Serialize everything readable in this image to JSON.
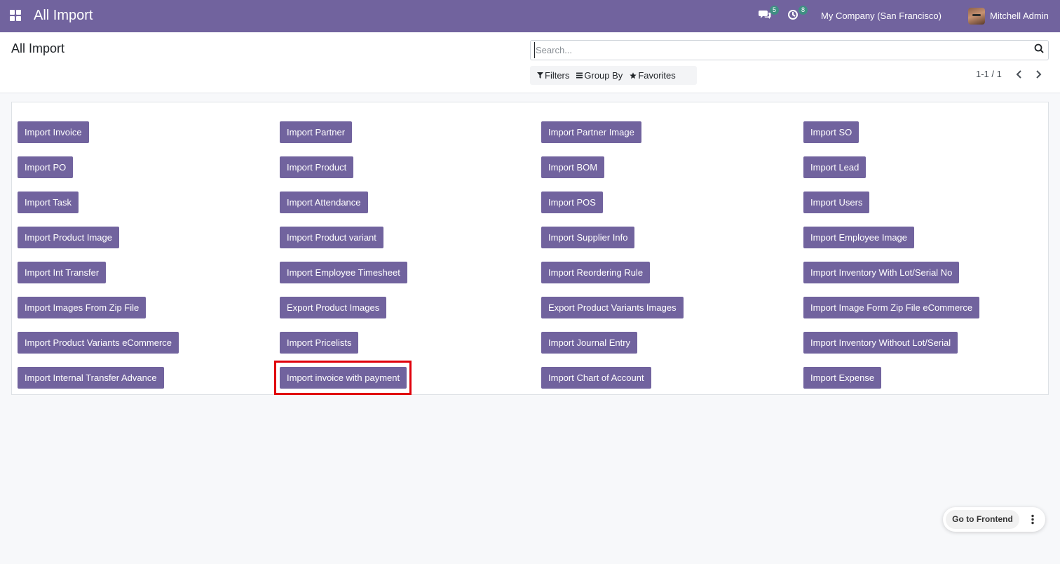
{
  "navbar": {
    "app_title": "All Import",
    "messages_badge": "5",
    "activities_badge": "8",
    "company": "My Company (San Francisco)",
    "user": "Mitchell Admin"
  },
  "control_panel": {
    "breadcrumb": "All Import",
    "search_placeholder": "Search...",
    "filters_label": "Filters",
    "group_by_label": "Group By",
    "favorites_label": "Favorites",
    "pager": "1-1 / 1"
  },
  "imports": {
    "col1": [
      "Import Invoice",
      "Import PO",
      "Import Task",
      "Import Product Image",
      "Import Int Transfer",
      "Import Images From Zip File",
      "Import Product Variants eCommerce",
      "Import Internal Transfer Advance"
    ],
    "col2": [
      "Import Partner",
      "Import Product",
      "Import Attendance",
      "Import Product variant",
      "Import Employee Timesheet",
      "Export Product Images",
      "Import Pricelists",
      "Import invoice with payment"
    ],
    "col3": [
      "Import Partner Image",
      "Import BOM",
      "Import POS",
      "Import Supplier Info",
      "Import Reordering Rule",
      "Export Product Variants Images",
      "Import Journal Entry",
      "Import Chart of Account"
    ],
    "col4": [
      "Import SO",
      "Import Lead",
      "Import Users",
      "Import Employee Image",
      "Import Inventory With Lot/Serial No",
      "Import Image Form Zip File eCommerce",
      "Import Inventory Without Lot/Serial",
      "Import Expense"
    ]
  },
  "floating": {
    "frontend_label": "Go to Frontend"
  },
  "colors": {
    "brand": "#71639e",
    "highlight": "#e0000b",
    "badge": "#3f8f83"
  }
}
